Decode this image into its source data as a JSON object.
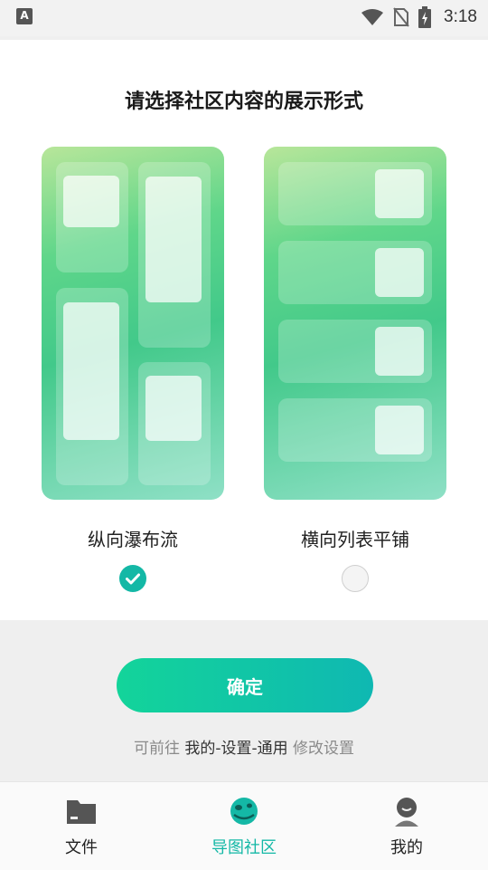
{
  "status_bar": {
    "time": "3:18",
    "notification_letter": "A"
  },
  "title": "请选择社区内容的展示形式",
  "options": [
    {
      "label": "纵向瀑布流",
      "selected": true
    },
    {
      "label": "横向列表平铺",
      "selected": false
    }
  ],
  "confirm_label": "确定",
  "hint": {
    "prefix": "可前往",
    "path": "我的-设置-通用",
    "suffix": "修改设置"
  },
  "tabs": [
    {
      "label": "文件",
      "icon": "folder-icon",
      "active": false
    },
    {
      "label": "导图社区",
      "icon": "planet-icon",
      "active": true
    },
    {
      "label": "我的",
      "icon": "user-icon",
      "active": false
    }
  ],
  "colors": {
    "accent": "#14b8a6",
    "button_start": "#13d49a",
    "button_end": "#0fb8b2"
  }
}
